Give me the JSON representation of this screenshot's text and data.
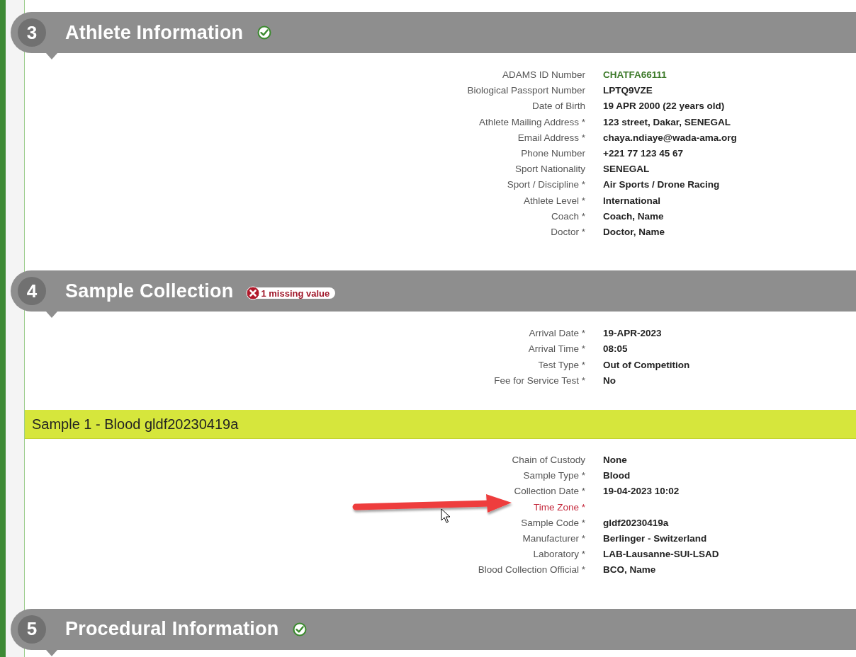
{
  "sections": [
    {
      "number": "3",
      "title": "Athlete Information",
      "status": {
        "kind": "complete"
      },
      "groups": [
        {
          "fields": [
            {
              "label": "ADAMS ID Number",
              "value": "CHATFA66111",
              "kind": "link",
              "missing": false
            },
            {
              "label": "Biological Passport Number",
              "value": "LPTQ9VZE",
              "kind": "text",
              "missing": false
            },
            {
              "label": "Date of Birth",
              "value": "19 APR 2000 (22 years old)",
              "kind": "text",
              "missing": false
            },
            {
              "label": "Athlete Mailing Address *",
              "value": "123 street, Dakar, SENEGAL",
              "kind": "text",
              "missing": false
            },
            {
              "label": "Email Address *",
              "value": "chaya.ndiaye@wada-ama.org",
              "kind": "text",
              "missing": false
            },
            {
              "label": "Phone Number",
              "value": "+221 77 123 45 67",
              "kind": "text",
              "missing": false
            },
            {
              "label": "Sport Nationality",
              "value": "SENEGAL",
              "kind": "text",
              "missing": false
            },
            {
              "label": "Sport / Discipline *",
              "value": "Air Sports / Drone Racing",
              "kind": "text",
              "missing": false
            },
            {
              "label": "Athlete Level *",
              "value": "International",
              "kind": "text",
              "missing": false
            },
            {
              "label": "Coach *",
              "value": "Coach, Name",
              "kind": "text",
              "missing": false
            },
            {
              "label": "Doctor *",
              "value": "Doctor, Name",
              "kind": "text",
              "missing": false
            }
          ]
        }
      ]
    },
    {
      "number": "4",
      "title": "Sample Collection",
      "status": {
        "kind": "missing",
        "label": "1 missing value"
      },
      "groups": [
        {
          "fields": [
            {
              "label": "Arrival Date *",
              "value": "19-APR-2023",
              "kind": "text",
              "missing": false
            },
            {
              "label": "Arrival Time *",
              "value": "08:05",
              "kind": "text",
              "missing": false
            },
            {
              "label": "Test Type *",
              "value": "Out of Competition",
              "kind": "text",
              "missing": false
            },
            {
              "label": "Fee for Service Test *",
              "value": "No",
              "kind": "text",
              "missing": false
            }
          ]
        },
        {
          "title": "Sample 1 - Blood gldf20230419a",
          "fields": [
            {
              "label": "Chain of Custody",
              "value": "None",
              "kind": "text",
              "missing": false
            },
            {
              "label": "Sample Type *",
              "value": "Blood",
              "kind": "text",
              "missing": false
            },
            {
              "label": "Collection Date *",
              "value": "19-04-2023 10:02",
              "kind": "text",
              "missing": false
            },
            {
              "label": "Time Zone *",
              "kind": "text",
              "missing": true
            },
            {
              "label": "Sample Code *",
              "value": "gldf20230419a",
              "kind": "text",
              "missing": false
            },
            {
              "label": "Manufacturer *",
              "value": "Berlinger - Switzerland",
              "kind": "text",
              "missing": false
            },
            {
              "label": "Laboratory *",
              "value": "LAB-Lausanne-SUI-LSAD",
              "kind": "text",
              "missing": false
            },
            {
              "label": "Blood Collection Official *",
              "value": "BCO, Name",
              "kind": "text",
              "missing": false
            }
          ]
        }
      ]
    },
    {
      "number": "5",
      "title": "Procedural Information",
      "status": {
        "kind": "complete"
      }
    }
  ]
}
